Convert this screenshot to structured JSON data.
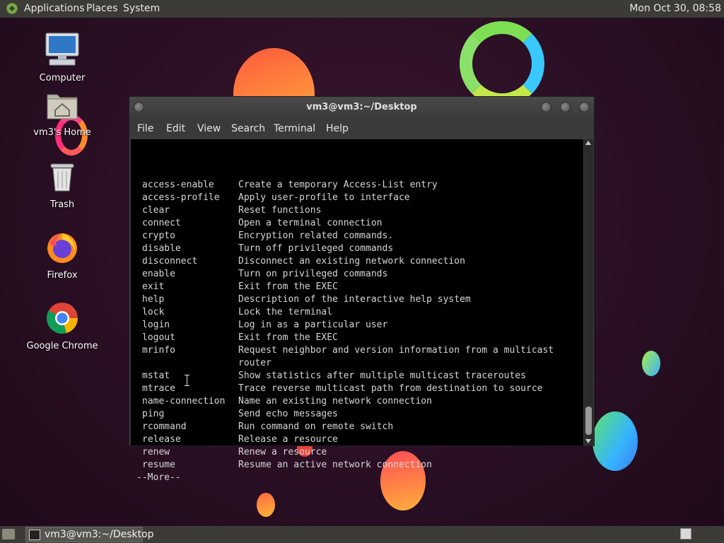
{
  "top_panel": {
    "menus": [
      "Applications",
      "Places",
      "System"
    ],
    "clock": "Mon Oct 30, 08:58"
  },
  "desktop_icons": [
    {
      "label": "Computer",
      "icon": "computer-icon"
    },
    {
      "label": "vm3's Home",
      "icon": "home-folder-icon"
    },
    {
      "label": "Trash",
      "icon": "trash-icon"
    },
    {
      "label": "Firefox",
      "icon": "firefox-icon"
    },
    {
      "label": "Google Chrome",
      "icon": "chrome-icon"
    }
  ],
  "window": {
    "title": "vm3@vm3:~/Desktop",
    "menus": [
      "File",
      "Edit",
      "View",
      "Search",
      "Terminal",
      "Help"
    ]
  },
  "terminal": {
    "lines": [
      {
        "cmd": "access-enable",
        "desc": "Create a temporary Access-List entry"
      },
      {
        "cmd": "access-profile",
        "desc": "Apply user-profile to interface"
      },
      {
        "cmd": "clear",
        "desc": "Reset functions"
      },
      {
        "cmd": "connect",
        "desc": "Open a terminal connection"
      },
      {
        "cmd": "crypto",
        "desc": "Encryption related commands."
      },
      {
        "cmd": "disable",
        "desc": "Turn off privileged commands"
      },
      {
        "cmd": "disconnect",
        "desc": "Disconnect an existing network connection"
      },
      {
        "cmd": "enable",
        "desc": "Turn on privileged commands"
      },
      {
        "cmd": "exit",
        "desc": "Exit from the EXEC"
      },
      {
        "cmd": "help",
        "desc": "Description of the interactive help system"
      },
      {
        "cmd": "lock",
        "desc": "Lock the terminal"
      },
      {
        "cmd": "login",
        "desc": "Log in as a particular user"
      },
      {
        "cmd": "logout",
        "desc": "Exit from the EXEC"
      },
      {
        "cmd": "mrinfo",
        "desc": "Request neighbor and version information from a multicast"
      },
      {
        "cmd": "",
        "desc": "router"
      },
      {
        "cmd": "mstat",
        "desc": "Show statistics after multiple multicast traceroutes"
      },
      {
        "cmd": "mtrace",
        "desc": "Trace reverse multicast path from destination to source"
      },
      {
        "cmd": "name-connection",
        "desc": "Name an existing network connection"
      },
      {
        "cmd": "ping",
        "desc": "Send echo messages"
      },
      {
        "cmd": "rcommand",
        "desc": "Run command on remote switch"
      },
      {
        "cmd": "release",
        "desc": "Release a resource"
      },
      {
        "cmd": "renew",
        "desc": "Renew a resource"
      },
      {
        "cmd": "resume",
        "desc": "Resume an active network connection"
      }
    ],
    "more_prompt": "--More--"
  },
  "taskbar": {
    "task_label": "vm3@vm3:~/Desktop"
  }
}
